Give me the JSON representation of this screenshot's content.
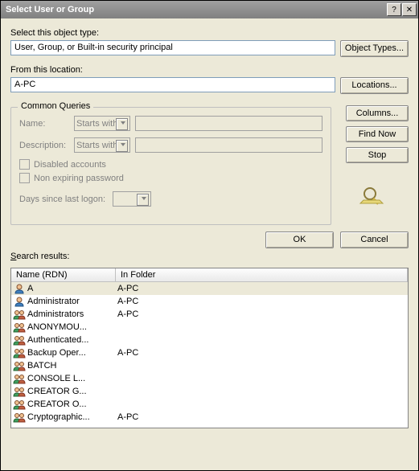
{
  "window": {
    "title": "Select User or Group"
  },
  "object_type": {
    "label": "Select this object type:",
    "value": "User, Group, or Built-in security principal",
    "button": "Object Types..."
  },
  "location": {
    "label": "From this location:",
    "value": "A-PC",
    "button": "Locations..."
  },
  "queries": {
    "legend": "Common Queries",
    "name_label": "Name:",
    "name_combo": "Starts with",
    "desc_label": "Description:",
    "desc_combo": "Starts with",
    "disabled_label": "Disabled accounts",
    "nonexpire_label": "Non expiring password",
    "days_label": "Days since last logon:"
  },
  "side_buttons": {
    "columns": "Columns...",
    "find_now": "Find Now",
    "stop": "Stop"
  },
  "footer": {
    "ok": "OK",
    "cancel": "Cancel"
  },
  "results": {
    "label": "Search results:",
    "columns": {
      "name": "Name (RDN)",
      "folder": "In Folder"
    },
    "rows": [
      {
        "name": "A",
        "folder": "A-PC",
        "icon": "user",
        "selected": true
      },
      {
        "name": "Administrator",
        "folder": "A-PC",
        "icon": "user"
      },
      {
        "name": "Administrators",
        "folder": "A-PC",
        "icon": "group"
      },
      {
        "name": "ANONYMOU...",
        "folder": "",
        "icon": "group"
      },
      {
        "name": "Authenticated...",
        "folder": "",
        "icon": "group"
      },
      {
        "name": "Backup Oper...",
        "folder": "A-PC",
        "icon": "group"
      },
      {
        "name": "BATCH",
        "folder": "",
        "icon": "group"
      },
      {
        "name": "CONSOLE L...",
        "folder": "",
        "icon": "group"
      },
      {
        "name": "CREATOR G...",
        "folder": "",
        "icon": "group"
      },
      {
        "name": "CREATOR O...",
        "folder": "",
        "icon": "group"
      },
      {
        "name": "Cryptographic...",
        "folder": "A-PC",
        "icon": "group"
      }
    ]
  }
}
